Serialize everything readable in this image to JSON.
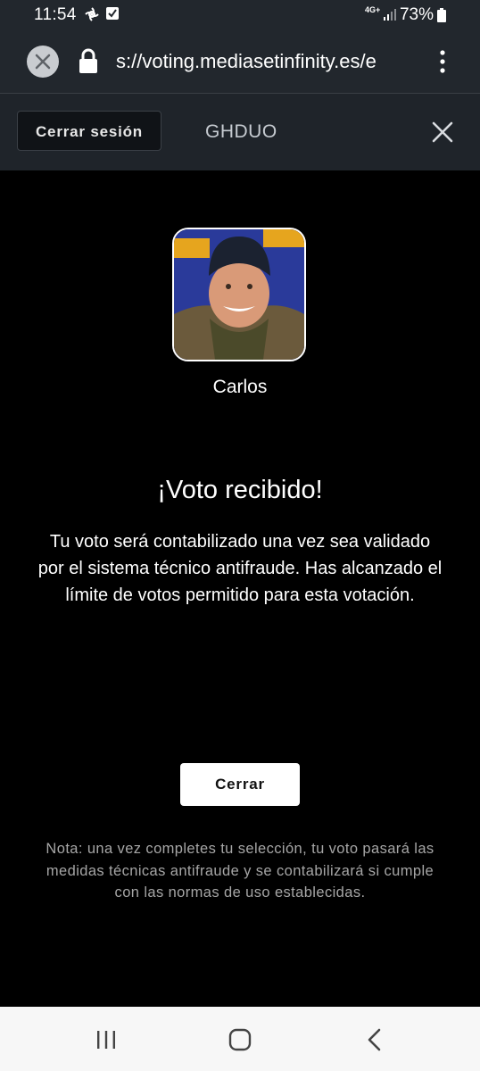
{
  "status_bar": {
    "time": "11:54",
    "network": "4G+",
    "battery": "73%"
  },
  "browser": {
    "url": "s://voting.mediasetinfinity.es/e"
  },
  "site_header": {
    "logout_label": "Cerrar sesión",
    "program": "GHDUO"
  },
  "candidate": {
    "name": "Carlos"
  },
  "confirmation": {
    "title": "¡Voto recibido!",
    "message": "Tu voto será contabilizado una vez sea validado por el sistema técnico antifraude. Has alcanzado el límite de votos permitido para esta votación."
  },
  "actions": {
    "close_label": "Cerrar"
  },
  "note": "Nota: una vez completes tu selección, tu voto pasará las medidas técnicas antifraude y se contabilizará si cumple con las normas de uso establecidas.",
  "icons": {
    "tab_close": "close-icon",
    "lock": "lock-icon",
    "menu": "more-vert-icon",
    "header_close": "close-icon",
    "nav_recent": "recent-apps-icon",
    "nav_home": "home-icon",
    "nav_back": "back-icon"
  },
  "colors": {
    "background": "#000000",
    "header": "#1f242a",
    "toolbar": "#22272d",
    "note": "#a6a6a6",
    "button": "#ffffff"
  }
}
